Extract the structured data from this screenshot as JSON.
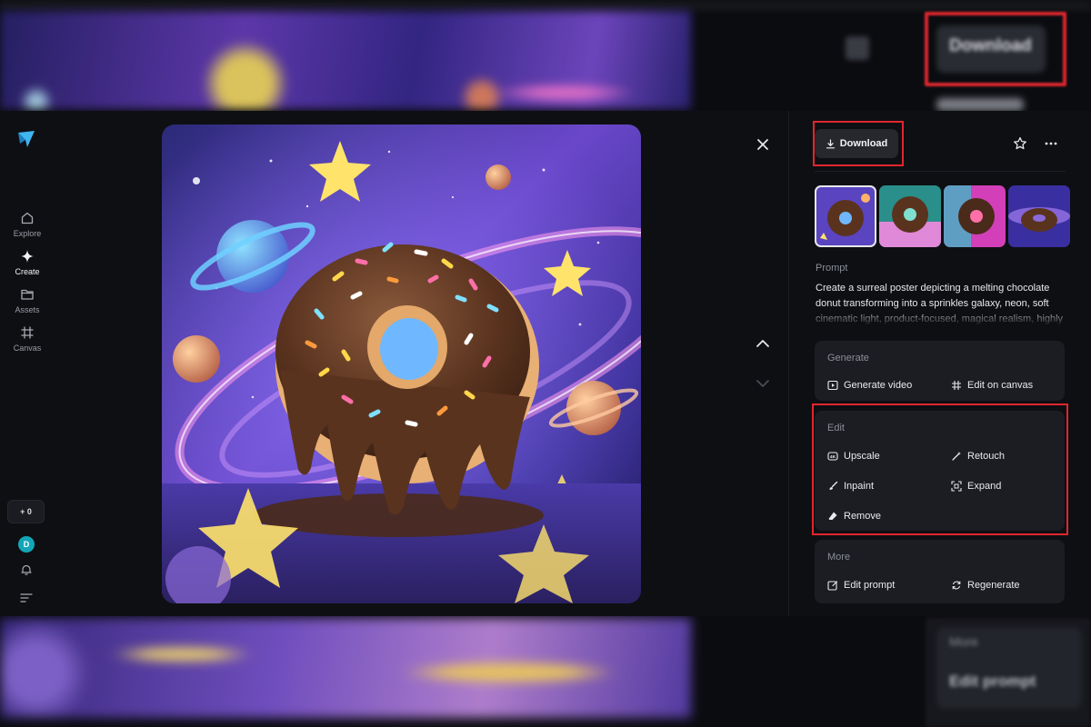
{
  "background": {
    "download_label": "Download",
    "more_label": "More",
    "edit_prompt_label": "Edit prompt"
  },
  "nav": {
    "items": [
      {
        "label": "Explore",
        "icon": "home-icon"
      },
      {
        "label": "Create",
        "icon": "sparkle-icon"
      },
      {
        "label": "Assets",
        "icon": "folder-icon"
      },
      {
        "label": "Canvas",
        "icon": "canvas-icon"
      }
    ],
    "active": "Create",
    "credits": "+ 0",
    "avatar_initial": "D"
  },
  "panel": {
    "download_label": "Download",
    "prompt_label": "Prompt",
    "prompt_text": "Create a surreal poster depicting a melting chocolate donut transforming into a sprinkles galaxy, neon, soft cinematic light, product-focused, magical realism, highly detailed",
    "sections": {
      "generate": {
        "title": "Generate",
        "actions": [
          {
            "label": "Generate video",
            "icon": "play-icon"
          },
          {
            "label": "Edit on canvas",
            "icon": "canvas-icon"
          }
        ]
      },
      "edit": {
        "title": "Edit",
        "actions": [
          {
            "label": "Upscale",
            "icon": "hd-icon"
          },
          {
            "label": "Retouch",
            "icon": "magic-wand-icon"
          },
          {
            "label": "Inpaint",
            "icon": "brush-icon"
          },
          {
            "label": "Expand",
            "icon": "expand-icon"
          },
          {
            "label": "Remove",
            "icon": "eraser-icon"
          }
        ]
      },
      "more": {
        "title": "More",
        "actions": [
          {
            "label": "Edit prompt",
            "icon": "edit-icon"
          },
          {
            "label": "Regenerate",
            "icon": "refresh-icon"
          }
        ]
      }
    }
  },
  "colors": {
    "accent_highlight": "#e1262d",
    "panel_bg": "#1c1d23",
    "modal_bg": "#0e0f13",
    "avatar": "#14a6b8"
  }
}
